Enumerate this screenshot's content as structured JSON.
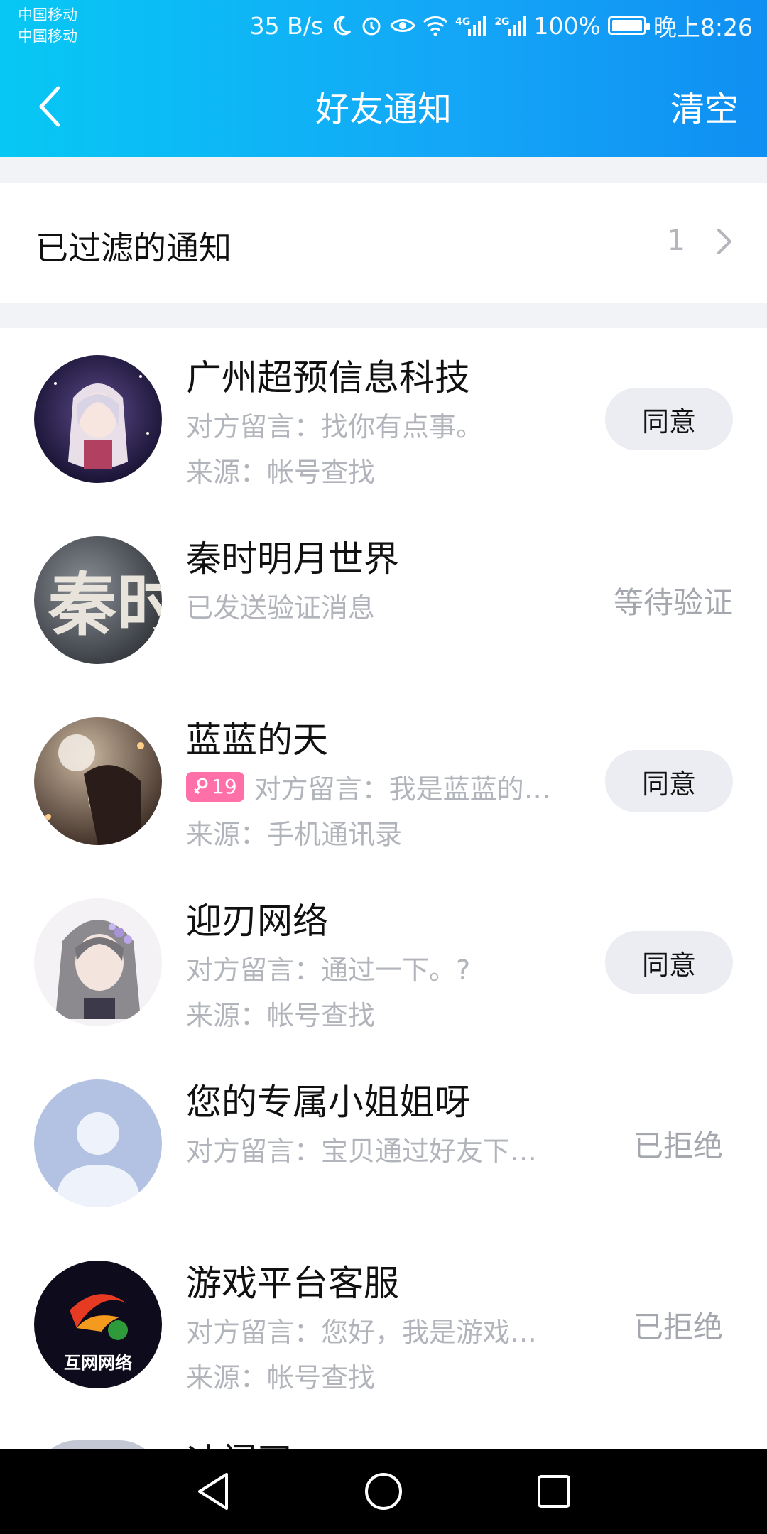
{
  "status_bar": {
    "carrier_1": "中国移动",
    "carrier_2": "中国移动",
    "speed": "35 B/s",
    "net_4g": "4G",
    "net_2g": "2G",
    "battery": "100%",
    "time": "晚上8:26",
    "icons": [
      "moon-icon",
      "alarm-icon",
      "eye-icon",
      "wifi-icon",
      "signal-4g-icon",
      "signal-2g-icon",
      "battery-icon"
    ]
  },
  "nav": {
    "title": "好友通知",
    "clear_label": "清空",
    "back_icon": "chevron-left-icon"
  },
  "filtered": {
    "label": "已过滤的通知",
    "count": "1"
  },
  "items": [
    {
      "name": "广州超预信息科技",
      "line1": "对方留言：找你有点事。",
      "line2": "来源：帐号查找",
      "action": "同意"
    },
    {
      "name": "秦时明月世界",
      "line1": "已发送验证消息",
      "line2": "",
      "status": "等待验证",
      "avatar_text": "秦时"
    },
    {
      "name": "蓝蓝的天",
      "badge": "19",
      "line1": "对方留言：我是蓝蓝的…",
      "line2": "来源：手机通讯录",
      "action": "同意"
    },
    {
      "name": "迎刃网络",
      "line1": "对方留言：通过一下。?",
      "line2": "来源：帐号查找",
      "action": "同意"
    },
    {
      "name": "您的专属小姐姐呀",
      "line1": "对方留言：宝贝通过好友下…",
      "line2": "",
      "status": "已拒绝"
    },
    {
      "name": "游戏平台客服",
      "line1": "对方留言：您好，我是游戏…",
      "line2": "来源：帐号查找",
      "status": "已拒绝",
      "avatar_text": "互网网络"
    }
  ],
  "peek_item": {
    "name": "迪门司"
  },
  "colors": {
    "header_start": "#07c8f4",
    "header_end": "#0f8ff2",
    "badge": "#ff6fa8",
    "button_bg": "#ebedf2",
    "muted_text": "#b1b4ba"
  }
}
